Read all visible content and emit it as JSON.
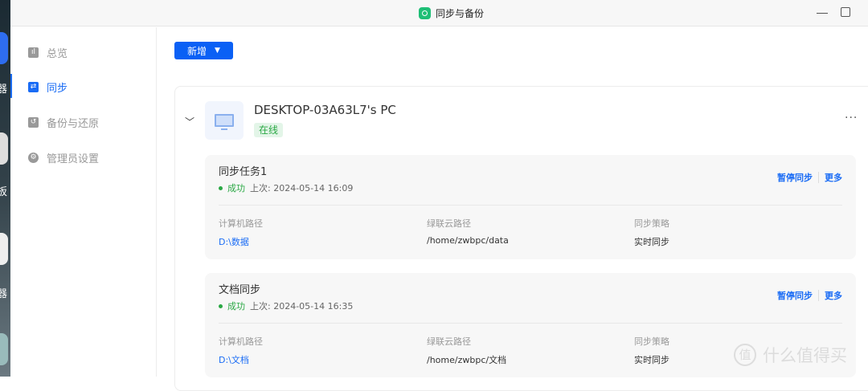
{
  "desktop": {
    "labels": [
      "器",
      "板",
      "器"
    ]
  },
  "window": {
    "title": "同步与备份"
  },
  "sidebar": {
    "items": [
      {
        "label": "总览",
        "icon": "chart-icon"
      },
      {
        "label": "同步",
        "icon": "sync-icon",
        "active": true
      },
      {
        "label": "备份与还原",
        "icon": "backup-icon"
      },
      {
        "label": "管理员设置",
        "icon": "gear-icon"
      }
    ]
  },
  "toolbar": {
    "new_label": "新增"
  },
  "device": {
    "name": "DESKTOP-03A63L7's PC",
    "status": "在线"
  },
  "tasks": [
    {
      "title": "同步任务1",
      "status": "成功",
      "last": "上次: 2024-05-14 16:09",
      "pause": "暂停同步",
      "more": "更多",
      "cols": [
        {
          "label": "计算机路径",
          "value": "D:\\数据"
        },
        {
          "label": "绿联云路径",
          "value": "/home/zwbpc/data"
        },
        {
          "label": "同步策略",
          "value": "实时同步"
        }
      ]
    },
    {
      "title": "文档同步",
      "status": "成功",
      "last": "上次: 2024-05-14 16:35",
      "pause": "暂停同步",
      "more": "更多",
      "cols": [
        {
          "label": "计算机路径",
          "value": "D:\\文档"
        },
        {
          "label": "绿联云路径",
          "value": "/home/zwbpc/文档"
        },
        {
          "label": "同步策略",
          "value": "实时同步"
        }
      ]
    }
  ],
  "watermark": {
    "text": "什么值得买",
    "mark": "值"
  }
}
